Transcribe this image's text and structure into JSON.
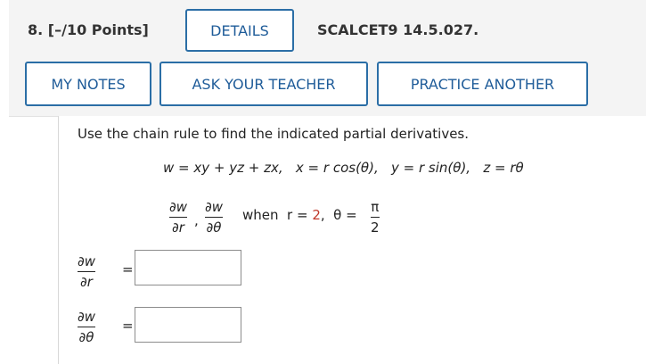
{
  "question": {
    "number_label": "8.  [–/10 Points]",
    "details_label": "DETAILS",
    "code": "SCALCET9 14.5.027."
  },
  "toolbar": {
    "my_notes_label": "MY NOTES",
    "ask_teacher_label": "ASK YOUR TEACHER",
    "practice_label": "PRACTICE ANOTHER"
  },
  "problem": {
    "instruction": "Use the chain rule to find the indicated partial derivatives.",
    "equations": "w = xy + yz + zx,   x = r cos(θ),   y = r sin(θ),   z = rθ",
    "d_num": "∂w",
    "dr_den": "∂r",
    "dtheta_den": "∂θ",
    "comma": ",",
    "when_text": "when  r = ",
    "r_value": "2",
    "theta_text": ",  θ = ",
    "pi": "π",
    "two": "2"
  },
  "answers": {
    "eq_sign": "=",
    "dw_dr_value": "",
    "dw_dtheta_value": ""
  }
}
